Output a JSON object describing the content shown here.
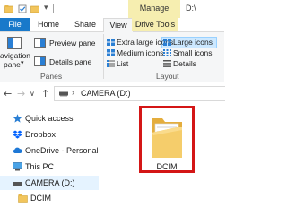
{
  "titlebar": {
    "context_tab": "Manage",
    "drive_letter": "D:\\"
  },
  "tabs": {
    "file": "File",
    "home": "Home",
    "share": "Share",
    "view": "View",
    "drive_tools": "Drive Tools"
  },
  "ribbon": {
    "navigation_pane": "Navigation pane",
    "navigation_pane_line1": "avigation",
    "navigation_pane_line2": "pane",
    "preview_pane": "Preview pane",
    "details_pane": "Details pane",
    "panes_group": "Panes",
    "extra_large_icons": "Extra large icons",
    "medium_icons": "Medium icons",
    "list": "List",
    "large_icons": "Large icons",
    "small_icons": "Small icons",
    "details": "Details",
    "layout_group": "Layout"
  },
  "address": {
    "path_sep": "›",
    "location": "CAMERA (D:)"
  },
  "nav_pane": {
    "items": [
      {
        "label": "Quick access",
        "icon": "star-icon"
      },
      {
        "label": "Dropbox",
        "icon": "dropbox-icon"
      },
      {
        "label": "OneDrive - Personal",
        "icon": "onedrive-cloud-icon"
      },
      {
        "label": "This PC",
        "icon": "computer-icon"
      },
      {
        "label": "CAMERA (D:)",
        "icon": "drive-icon"
      },
      {
        "label": "DCIM",
        "icon": "folder-icon"
      }
    ]
  },
  "content": {
    "folder_name": "DCIM"
  },
  "colors": {
    "file_tab": "#1979ca",
    "manage_highlight": "#f6eeb0",
    "selection": "#cce8ff",
    "callout": "#d41616",
    "folder": "#f2c55c"
  }
}
